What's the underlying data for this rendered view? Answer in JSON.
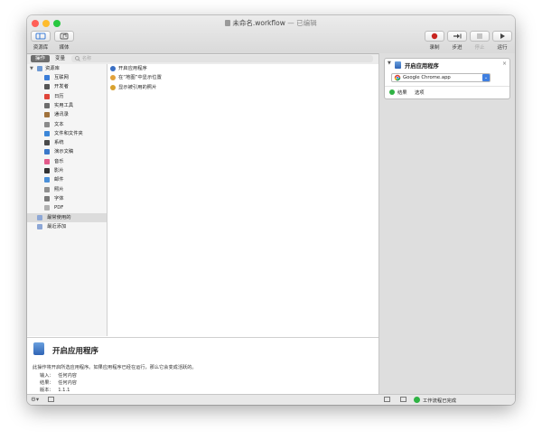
{
  "window": {
    "title": "未命名.workflow",
    "title_separator": "—",
    "title_status": "已编辑"
  },
  "toolbar": {
    "library_label": "资源库",
    "media_label": "媒体",
    "record_label": "录制",
    "step_label": "步进",
    "stop_label": "停止",
    "run_label": "运行"
  },
  "filter": {
    "actions_tab": "操作",
    "variables_tab": "变量",
    "search_placeholder": "名称"
  },
  "library": {
    "root": "资源库",
    "items": [
      {
        "label": "互联网",
        "icon": "globe-icon",
        "color": "#3b7dd8"
      },
      {
        "label": "开发者",
        "icon": "hammer-icon",
        "color": "#555555"
      },
      {
        "label": "日历",
        "icon": "calendar-icon",
        "color": "#e0453a"
      },
      {
        "label": "实用工具",
        "icon": "tools-icon",
        "color": "#6d6d6d"
      },
      {
        "label": "通讯录",
        "icon": "contacts-icon",
        "color": "#a0723c"
      },
      {
        "label": "文本",
        "icon": "text-icon",
        "color": "#8a8a8a"
      },
      {
        "label": "文件和文件夹",
        "icon": "finder-icon",
        "color": "#3b86d8"
      },
      {
        "label": "系统",
        "icon": "system-icon",
        "color": "#4a4a4a"
      },
      {
        "label": "演示文稿",
        "icon": "presentation-icon",
        "color": "#3a78c9"
      },
      {
        "label": "音乐",
        "icon": "music-icon",
        "color": "#e25a8a"
      },
      {
        "label": "影片",
        "icon": "movie-icon",
        "color": "#333333"
      },
      {
        "label": "邮件",
        "icon": "mail-icon",
        "color": "#4a90d9"
      },
      {
        "label": "照片",
        "icon": "photos-icon",
        "color": "#8f8f8f"
      },
      {
        "label": "字体",
        "icon": "font-icon",
        "color": "#7a7a7a"
      },
      {
        "label": "PDF",
        "icon": "pdf-icon",
        "color": "#b0b0b0"
      }
    ],
    "smart_folders": [
      {
        "label": "最常使用的",
        "icon": "smart-folder-icon",
        "color": "#8da7d6"
      },
      {
        "label": "最近添加",
        "icon": "smart-folder-icon",
        "color": "#8da7d6"
      }
    ]
  },
  "actions": [
    {
      "label": "开启应用程序",
      "icon": "app-icon",
      "color": "#3a6fc4"
    },
    {
      "label": "在“地图”中显示位置",
      "icon": "maps-icon",
      "color": "#e2a23b"
    },
    {
      "label": "显示被引用的照片",
      "icon": "photos-icon",
      "color": "#d8a12e"
    }
  ],
  "description": {
    "title": "开启应用程序",
    "text": "此操作将开启所选应用程序。如果应用程序已经在运行，那么它会变成活跃的。",
    "input_label": "输入：",
    "input_value": "任何内容",
    "result_label": "结果：",
    "result_value": "任何内容",
    "version_label": "版本：",
    "version_value": "1.1.1"
  },
  "workflow": {
    "card_title": "开启应用程序",
    "app_selected": "Google Chrome.app",
    "results_tab": "结果",
    "options_tab": "选项"
  },
  "status": {
    "text": "工作流程已完成"
  },
  "colors": {
    "close": "#ff5f57",
    "minimize": "#febc2e",
    "zoom": "#28c840",
    "record": "#c8241f",
    "selection": "#dcdcdc",
    "success": "#2fb344"
  }
}
